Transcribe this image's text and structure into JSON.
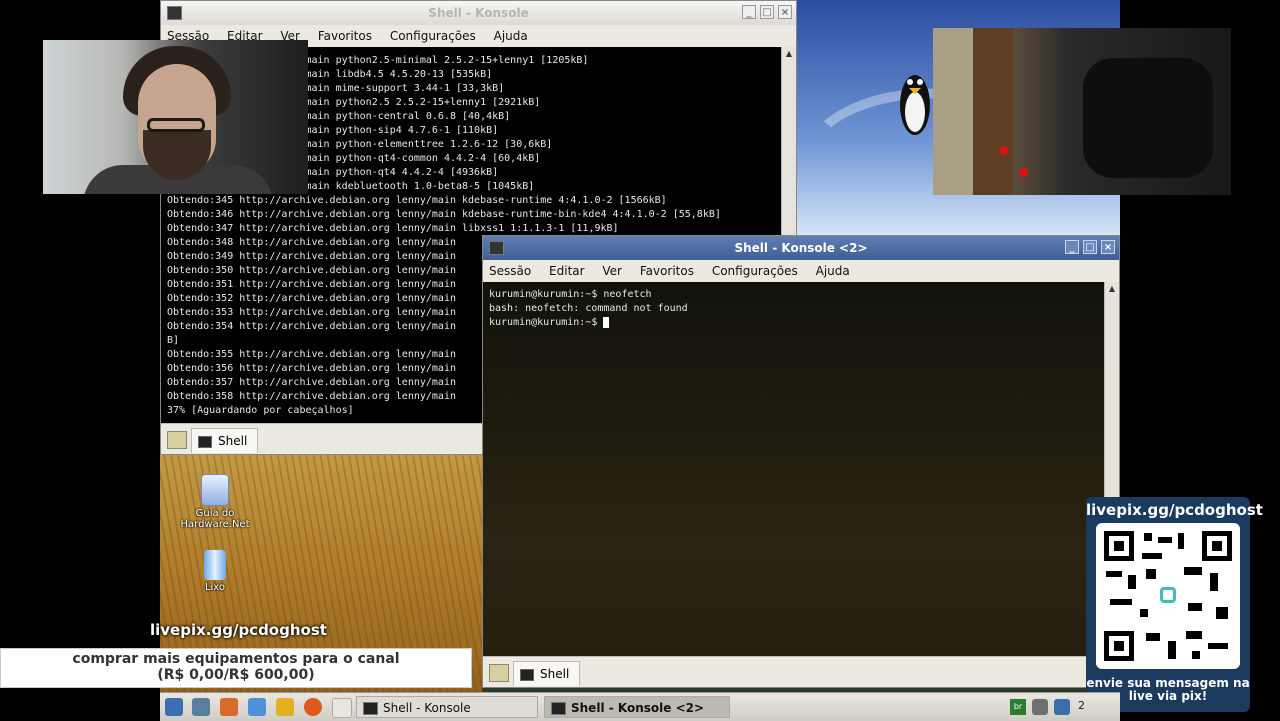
{
  "konsole1": {
    "title": "Shell - Konsole",
    "menu": [
      "Sessão",
      "Editar",
      "Ver",
      "Favoritos",
      "Configurações",
      "Ajuda"
    ],
    "lines": [
      "chive.debian.org lenny/main python2.5-minimal 2.5.2-15+lenny1 [1205kB]",
      "chive.debian.org lenny/main libdb4.5 4.5.20-13 [535kB]",
      "chive.debian.org lenny/main mime-support 3.44-1 [33,3kB]",
      "chive.debian.org lenny/main python2.5 2.5.2-15+lenny1 [2921kB]",
      "chive.debian.org lenny/main python-central 0.6.8 [40,4kB]",
      "chive.debian.org lenny/main python-sip4 4.7.6-1 [110kB]",
      "chive.debian.org lenny/main python-elementtree 1.2.6-12 [30,6kB]",
      "chive.debian.org lenny/main python-qt4-common 4.4.2-4 [60,4kB]",
      "chive.debian.org lenny/main python-qt4 4.4.2-4 [4936kB]",
      "chive.debian.org lenny/main kdebluetooth 1.0-beta8-5 [1045kB]",
      "Obtendo:345 http://archive.debian.org lenny/main kdebase-runtime 4:4.1.0-2 [1566kB]",
      "Obtendo:346 http://archive.debian.org lenny/main kdebase-runtime-bin-kde4 4:4.1.0-2 [55,8kB]",
      "Obtendo:347 http://archive.debian.org lenny/main libxss1 1:1.1.3-1 [11,9kB]",
      "Obtendo:348 http://archive.debian.org lenny/main",
      "Obtendo:349 http://archive.debian.org lenny/main",
      "Obtendo:350 http://archive.debian.org lenny/main",
      "Obtendo:351 http://archive.debian.org lenny/main",
      "Obtendo:352 http://archive.debian.org lenny/main",
      "Obtendo:353 http://archive.debian.org lenny/main",
      "Obtendo:354 http://archive.debian.org lenny/main",
      "B]",
      "Obtendo:355 http://archive.debian.org lenny/main",
      "Obtendo:356 http://archive.debian.org lenny/main",
      "Obtendo:357 http://archive.debian.org lenny/main",
      "Obtendo:358 http://archive.debian.org lenny/main",
      "37% [Aguardando por cabeçalhos]"
    ],
    "tab_label": "Shell"
  },
  "konsole2": {
    "title": "Shell - Konsole <2>",
    "menu": [
      "Sessão",
      "Editar",
      "Ver",
      "Favoritos",
      "Configurações",
      "Ajuda"
    ],
    "lines": [
      "kurumin@kurumin:~$ neofetch",
      "bash: neofetch: command not found"
    ],
    "prompt": "kurumin@kurumin:~$ ",
    "tab_label": "Shell"
  },
  "desktop_icons": [
    {
      "label": "Guia do Hardware.Net",
      "icon": "document-icon"
    },
    {
      "label": "Lixo",
      "icon": "trash-icon"
    }
  ],
  "overlays": {
    "live_url": "livepix.gg/pcdoghost",
    "goal_title": "comprar mais equipamentos para o canal",
    "goal_progress": "(R$ 0,00/R$ 600,00)",
    "goal_fraction": 0,
    "pix_url": "livepix.gg/pcdoghost",
    "pix_message": "envie sua mensagem na live via pix!"
  },
  "taskbar": {
    "tasks": [
      {
        "label": "Shell - Konsole",
        "current": false
      },
      {
        "label": "Shell - Konsole <2>",
        "current": true
      }
    ],
    "tray_partial": "2"
  }
}
